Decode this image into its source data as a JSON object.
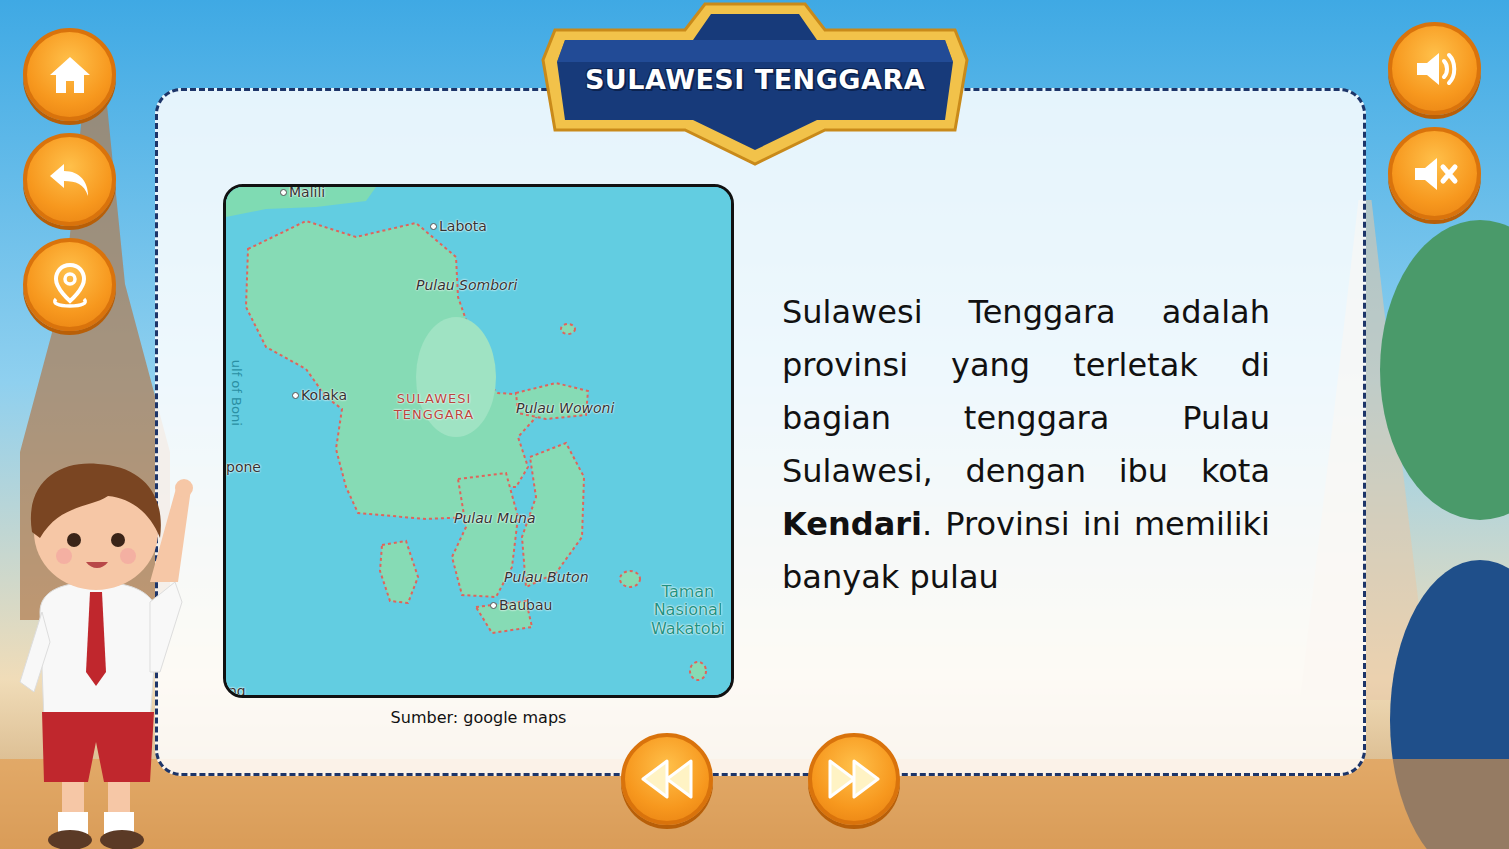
{
  "title": "SULAWESI TENGGARA",
  "map": {
    "labels": [
      {
        "text": "Malili",
        "kind": "town"
      },
      {
        "text": "Labota",
        "kind": "town"
      },
      {
        "text": "Pulau Sombori",
        "kind": "island"
      },
      {
        "text": "Kolaka",
        "kind": "town"
      },
      {
        "text": "SULAWESI TENGGARA",
        "kind": "region"
      },
      {
        "text": "Pulau Wowoni",
        "kind": "island"
      },
      {
        "text": "Pulau Muna",
        "kind": "island"
      },
      {
        "text": "Pulau Buton",
        "kind": "island"
      },
      {
        "text": "Baubau",
        "kind": "town"
      },
      {
        "text": "Taman Nasional Wakatobi",
        "kind": "park"
      },
      {
        "text": "ulf of Boni",
        "kind": "water"
      },
      {
        "text": "pone",
        "kind": "cut"
      },
      {
        "text": "ng",
        "kind": "cut"
      }
    ],
    "caption": "Sumber: google maps"
  },
  "description": [
    {
      "text": "Sulawesi Tenggara adalah provinsi yang terletak di bagian tenggara Pulau Sulawesi, dengan ibu kota ",
      "bold": false
    },
    {
      "text": "Kendari",
      "bold": true
    },
    {
      "text": ". Provinsi ini memiliki banyak pulau",
      "bold": false
    }
  ]
}
